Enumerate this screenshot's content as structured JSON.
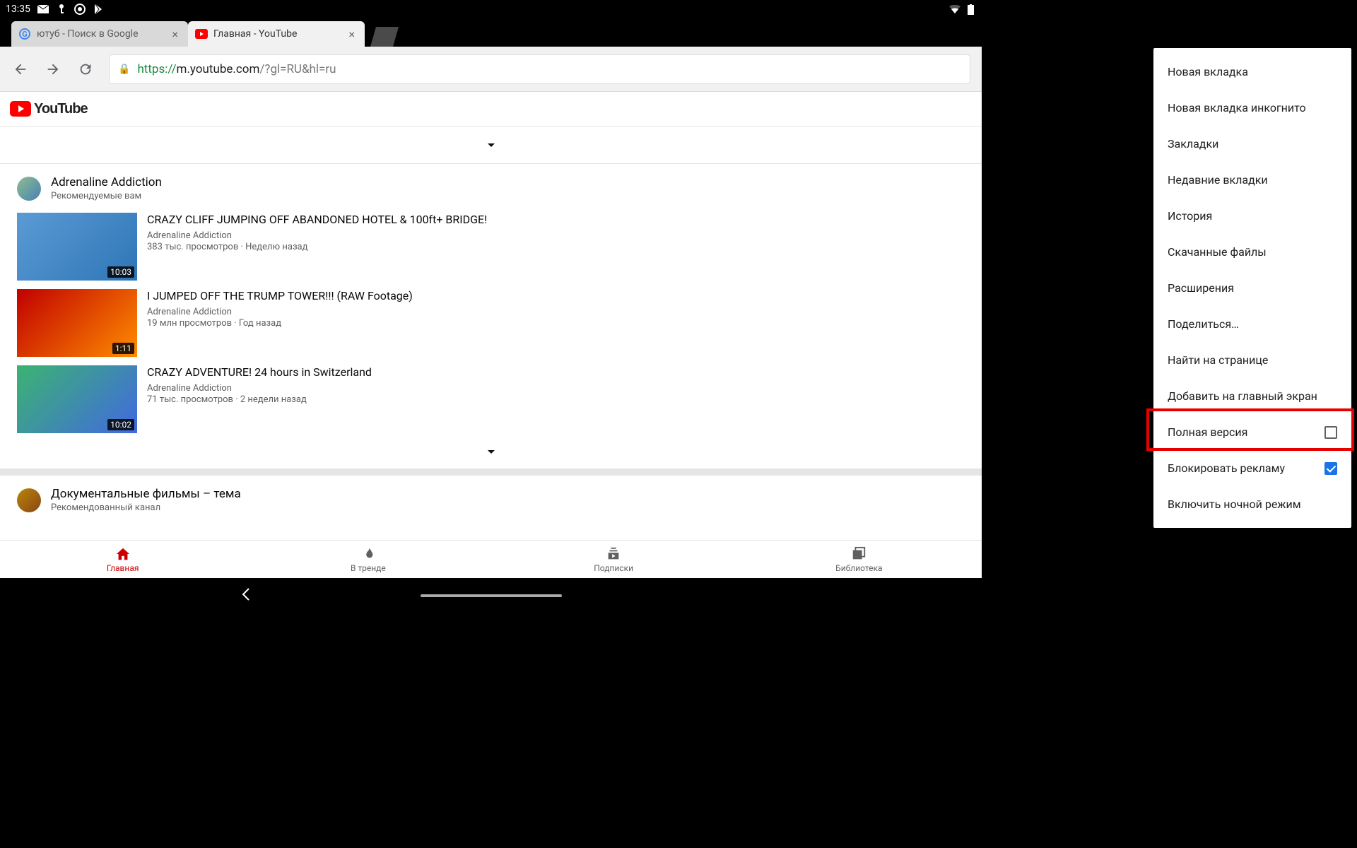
{
  "status": {
    "time": "13:35"
  },
  "tabs": [
    {
      "title": "ютуб - Поиск в Google",
      "active": false,
      "favicon": "google"
    },
    {
      "title": "Главная - YouTube",
      "active": true,
      "favicon": "youtube"
    }
  ],
  "url": {
    "scheme": "https://",
    "host": "m.youtube.com",
    "path": "/?gl=RU&hl=ru"
  },
  "youtube": {
    "logo_text": "YouTube",
    "bottom_nav": [
      {
        "label": "Главная",
        "icon": "home",
        "active": true
      },
      {
        "label": "В тренде",
        "icon": "trending",
        "active": false
      },
      {
        "label": "Подписки",
        "icon": "subscriptions",
        "active": false
      },
      {
        "label": "Библиотека",
        "icon": "library",
        "active": false
      }
    ],
    "sections": [
      {
        "channel": "Adrenaline Addiction",
        "subtitle": "Рекомендуемые вам",
        "videos": [
          {
            "title": "CRAZY CLIFF JUMPING OFF ABANDONED HOTEL & 100ft+ BRIDGE!",
            "channel": "Adrenaline Addiction",
            "meta": "383 тыс. просмотров · Неделю назад",
            "duration": "10:03"
          },
          {
            "title": "I JUMPED OFF THE TRUMP TOWER!!! (RAW Footage)",
            "channel": "Adrenaline Addiction",
            "meta": "19 млн просмотров · Год назад",
            "duration": "1:11"
          },
          {
            "title": "CRAZY ADVENTURE! 24 hours in Switzerland",
            "channel": "Adrenaline Addiction",
            "meta": "71 тыс. просмотров · 2 недели назад",
            "duration": "10:02"
          }
        ]
      },
      {
        "channel": "Документальные фильмы – тема",
        "subtitle": "Рекомендованный канал",
        "videos": []
      }
    ]
  },
  "menu": {
    "items": [
      {
        "label": "Новая вкладка"
      },
      {
        "label": "Новая вкладка инкогнито"
      },
      {
        "label": "Закладки"
      },
      {
        "label": "Недавние вкладки"
      },
      {
        "label": "История"
      },
      {
        "label": "Скачанные файлы"
      },
      {
        "label": "Расширения"
      },
      {
        "label": "Поделиться…"
      },
      {
        "label": "Найти на странице"
      },
      {
        "label": "Добавить на главный экран"
      },
      {
        "label": "Полная версия",
        "checkbox": true,
        "checked": false
      },
      {
        "label": "Блокировать рекламу",
        "checkbox": true,
        "checked": true
      },
      {
        "label": "Включить ночной режим"
      }
    ]
  }
}
